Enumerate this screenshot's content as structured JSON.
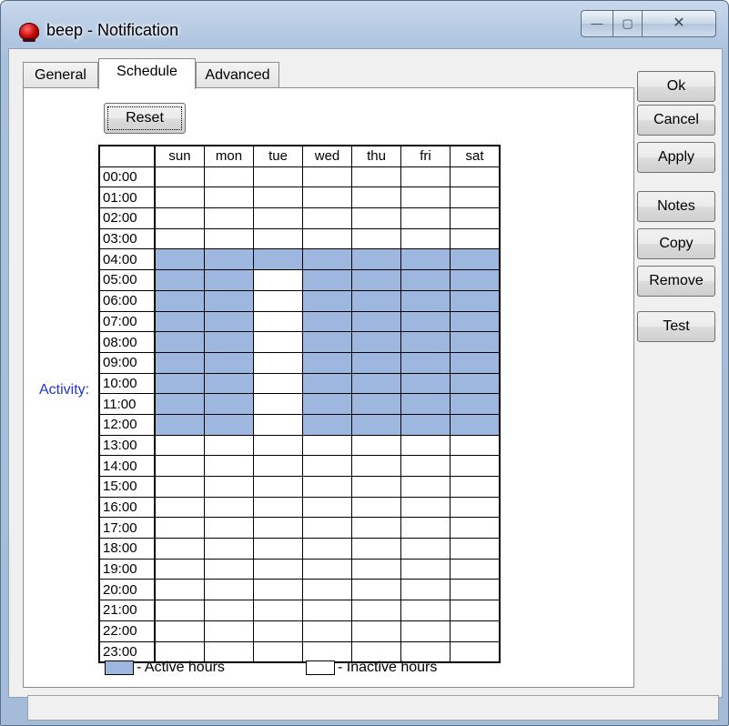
{
  "window": {
    "title": "beep - Notification",
    "close_glyph": "✕",
    "minimize_glyph": "—",
    "maximize_glyph": "▢"
  },
  "tabs": [
    {
      "label": "General"
    },
    {
      "label": "Schedule",
      "selected": true
    },
    {
      "label": "Advanced"
    }
  ],
  "schedule": {
    "reset_label": "Reset",
    "activity_label": "Activity:",
    "days": [
      "sun",
      "mon",
      "tue",
      "wed",
      "thu",
      "fri",
      "sat"
    ],
    "hours": [
      "00:00",
      "01:00",
      "02:00",
      "03:00",
      "04:00",
      "05:00",
      "06:00",
      "07:00",
      "08:00",
      "09:00",
      "10:00",
      "11:00",
      "12:00",
      "13:00",
      "14:00",
      "15:00",
      "16:00",
      "17:00",
      "18:00",
      "19:00",
      "20:00",
      "21:00",
      "22:00",
      "23:00"
    ],
    "active_hours": {
      "sun": [
        "04:00",
        "05:00",
        "06:00",
        "07:00",
        "08:00",
        "09:00",
        "10:00",
        "11:00",
        "12:00"
      ],
      "mon": [
        "04:00",
        "05:00",
        "06:00",
        "07:00",
        "08:00",
        "09:00",
        "10:00",
        "11:00",
        "12:00"
      ],
      "tue": [
        "04:00"
      ],
      "wed": [
        "04:00",
        "05:00",
        "06:00",
        "07:00",
        "08:00",
        "09:00",
        "10:00",
        "11:00",
        "12:00"
      ],
      "thu": [
        "04:00",
        "05:00",
        "06:00",
        "07:00",
        "08:00",
        "09:00",
        "10:00",
        "11:00",
        "12:00"
      ],
      "fri": [
        "04:00",
        "05:00",
        "06:00",
        "07:00",
        "08:00",
        "09:00",
        "10:00",
        "11:00",
        "12:00"
      ],
      "sat": [
        "04:00",
        "05:00",
        "06:00",
        "07:00",
        "08:00",
        "09:00",
        "10:00",
        "11:00",
        "12:00"
      ]
    },
    "legend_active": "- Active hours",
    "legend_inactive": "- Inactive hours"
  },
  "buttons": {
    "ok": "Ok",
    "cancel": "Cancel",
    "apply": "Apply",
    "notes": "Notes",
    "copy": "Copy",
    "remove": "Remove",
    "test": "Test"
  },
  "colors": {
    "active": "#9db7de",
    "inactive": "#ffffff",
    "activity_label": "#2233d0"
  },
  "status_bar": {
    "text": ""
  }
}
